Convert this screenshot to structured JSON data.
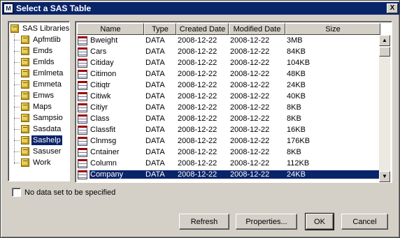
{
  "window": {
    "title": "Select a SAS Table",
    "icon_text": "M",
    "close_label": "X"
  },
  "tree": {
    "root": "SAS Libraries",
    "items": [
      {
        "label": "Apfmtlib",
        "selected": false
      },
      {
        "label": "Emds",
        "selected": false
      },
      {
        "label": "Emlds",
        "selected": false
      },
      {
        "label": "Emlmeta",
        "selected": false
      },
      {
        "label": "Emmeta",
        "selected": false
      },
      {
        "label": "Emws",
        "selected": false
      },
      {
        "label": "Maps",
        "selected": false
      },
      {
        "label": "Sampsio",
        "selected": false
      },
      {
        "label": "Sasdata",
        "selected": false
      },
      {
        "label": "Sashelp",
        "selected": true
      },
      {
        "label": "Sasuser",
        "selected": false
      },
      {
        "label": "Work",
        "selected": false
      }
    ]
  },
  "table": {
    "columns": [
      "Name",
      "Type",
      "Created Date",
      "Modified Date",
      "Size"
    ],
    "rows": [
      {
        "name": "Bweight",
        "type": "DATA",
        "created": "2008-12-22",
        "modified": "2008-12-22",
        "size": "3MB",
        "selected": false
      },
      {
        "name": "Cars",
        "type": "DATA",
        "created": "2008-12-22",
        "modified": "2008-12-22",
        "size": "84KB",
        "selected": false
      },
      {
        "name": "Citiday",
        "type": "DATA",
        "created": "2008-12-22",
        "modified": "2008-12-22",
        "size": "104KB",
        "selected": false
      },
      {
        "name": "Citimon",
        "type": "DATA",
        "created": "2008-12-22",
        "modified": "2008-12-22",
        "size": "48KB",
        "selected": false
      },
      {
        "name": "Citiqtr",
        "type": "DATA",
        "created": "2008-12-22",
        "modified": "2008-12-22",
        "size": "24KB",
        "selected": false
      },
      {
        "name": "Citiwk",
        "type": "DATA",
        "created": "2008-12-22",
        "modified": "2008-12-22",
        "size": "40KB",
        "selected": false
      },
      {
        "name": "Citiyr",
        "type": "DATA",
        "created": "2008-12-22",
        "modified": "2008-12-22",
        "size": "8KB",
        "selected": false
      },
      {
        "name": "Class",
        "type": "DATA",
        "created": "2008-12-22",
        "modified": "2008-12-22",
        "size": "8KB",
        "selected": false
      },
      {
        "name": "Classfit",
        "type": "DATA",
        "created": "2008-12-22",
        "modified": "2008-12-22",
        "size": "16KB",
        "selected": false
      },
      {
        "name": "Clnmsg",
        "type": "DATA",
        "created": "2008-12-22",
        "modified": "2008-12-22",
        "size": "176KB",
        "selected": false
      },
      {
        "name": "Cntainer",
        "type": "DATA",
        "created": "2008-12-22",
        "modified": "2008-12-22",
        "size": "8KB",
        "selected": false
      },
      {
        "name": "Column",
        "type": "DATA",
        "created": "2008-12-22",
        "modified": "2008-12-22",
        "size": "112KB",
        "selected": false
      },
      {
        "name": "Company",
        "type": "DATA",
        "created": "2008-12-22",
        "modified": "2008-12-22",
        "size": "24KB",
        "selected": true
      }
    ]
  },
  "options": {
    "no_dataset_label": "No data set to be specified",
    "no_dataset_checked": false
  },
  "buttons": {
    "refresh": "Refresh",
    "properties": "Properties...",
    "ok": "OK",
    "cancel": "Cancel"
  },
  "colors": {
    "title_bar": "#0a246a",
    "selection": "#0a246a",
    "face": "#d4d0c8"
  }
}
